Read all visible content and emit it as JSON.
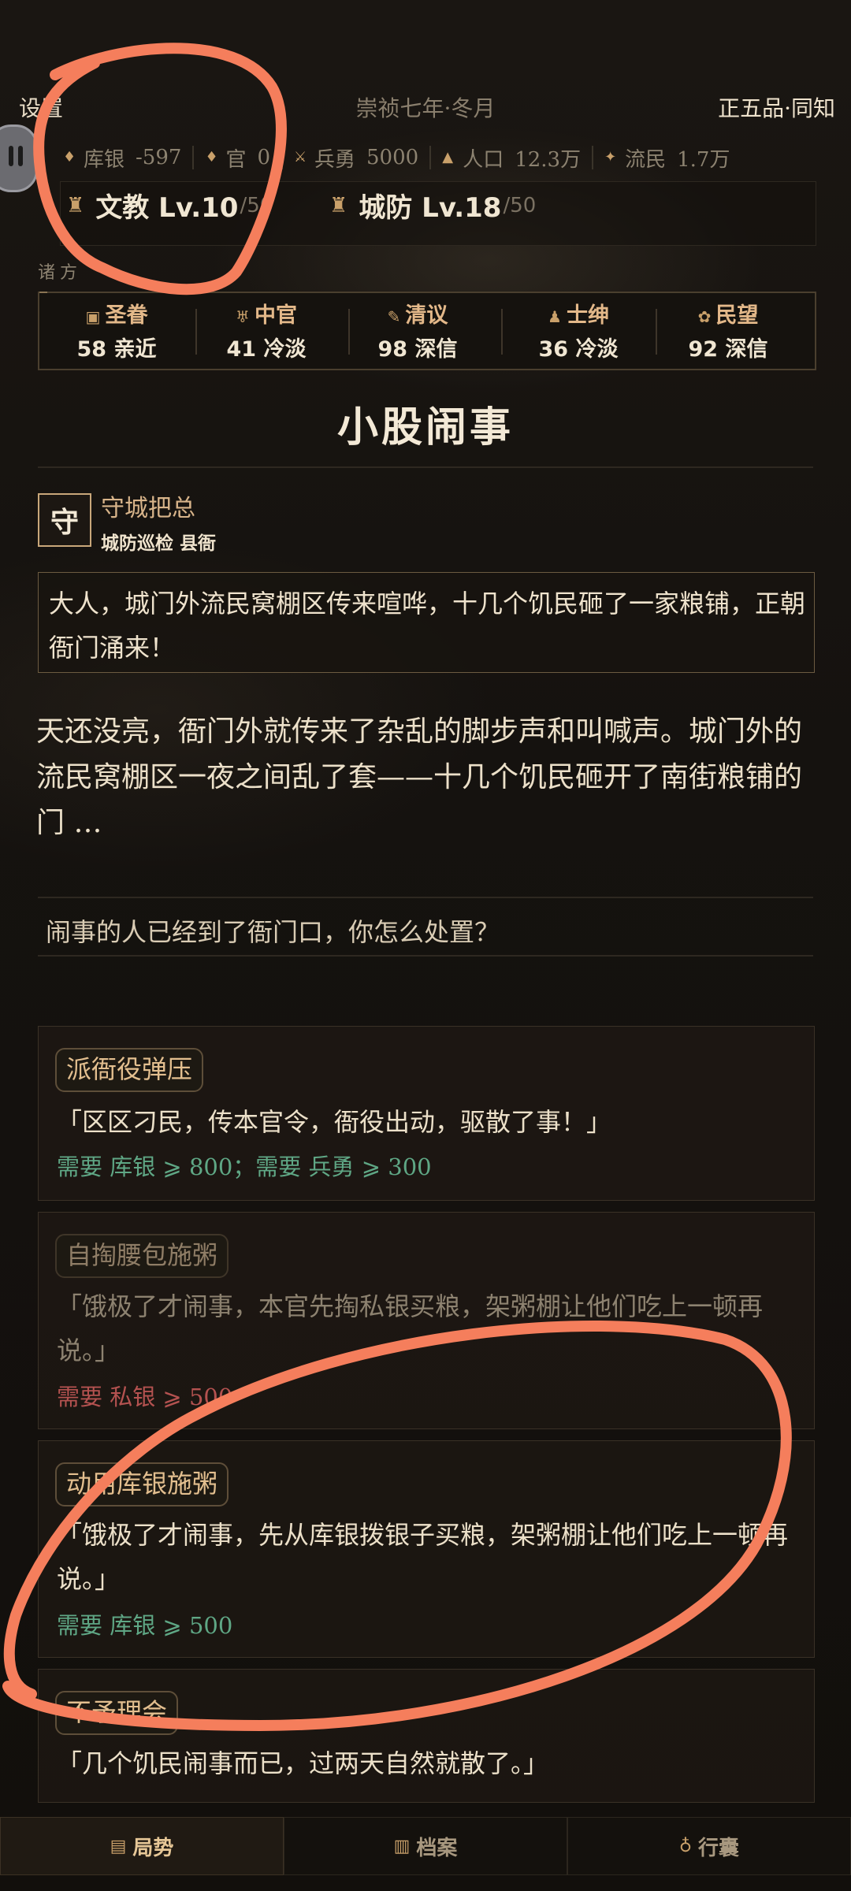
{
  "header": {
    "settings_label": "设置",
    "era": "崇祯七年·冬月",
    "rank": "正五品·同知"
  },
  "resources": [
    {
      "icon": "silver-icon",
      "label": "库银",
      "value": "-597"
    },
    {
      "icon": "official-silver-icon",
      "label": "官",
      "value": "0"
    },
    {
      "icon": "soldier-icon",
      "label": "兵勇",
      "value": "5000"
    },
    {
      "icon": "population-icon",
      "label": "人口",
      "value": "12.3万"
    },
    {
      "icon": "refugee-icon",
      "label": "流民",
      "value": "1.7万"
    }
  ],
  "levels": [
    {
      "icon": "education-icon",
      "label": "文教 Lv.10",
      "max": "/50"
    },
    {
      "icon": "defense-icon",
      "label": "城防 Lv.18",
      "max": "/50"
    }
  ],
  "factions_label": "诸方",
  "factions": [
    {
      "icon": "imperial-icon",
      "name": "圣眷",
      "value": "58 亲近"
    },
    {
      "icon": "eunuch-icon",
      "name": "中官",
      "value": "41 冷淡"
    },
    {
      "icon": "scholar-icon",
      "name": "清议",
      "value": "98 深信"
    },
    {
      "icon": "gentry-icon",
      "name": "士绅",
      "value": "36 冷淡"
    },
    {
      "icon": "people-icon",
      "name": "民望",
      "value": "92 深信"
    }
  ],
  "event": {
    "title": "小股闹事",
    "speaker_seal": "守",
    "speaker_name": "守城把总",
    "speaker_sub": "城防巡检 县衙",
    "speaker_quote": "大人，城门外流民窝棚区传来喧哗，十几个饥民砸了一家粮铺，正朝衙门涌来！",
    "narration": "天还没亮，衙门外就传来了杂乱的脚步声和叫喊声。城门外的流民窝棚区一夜之间乱了套——十几个饥民砸开了南街粮铺的门 …",
    "prompt": "闹事的人已经到了衙门口，你怎么处置？"
  },
  "choices": [
    {
      "tag": "派衙役弹压",
      "text": "「区区刁民，传本官令，衙役出动，驱散了事！」",
      "requirement": "需要 库银 ⩾ 800；需要 兵勇 ⩾ 300",
      "enabled": true
    },
    {
      "tag": "自掏腰包施粥",
      "text": "「饿极了才闹事，本官先掏私银买粮，架粥棚让他们吃上一顿再说。」",
      "requirement": "需要 私银 ⩾ 500",
      "enabled": false
    },
    {
      "tag": "动用库银施粥",
      "text": "「饿极了才闹事，先从库银拨银子买粮，架粥棚让他们吃上一顿再说。」",
      "requirement": "需要 库银 ⩾ 500",
      "enabled": true
    },
    {
      "tag": "不予理会",
      "text": "「几个饥民闹事而已，过两天自然就散了。」",
      "requirement": "",
      "enabled": true
    }
  ],
  "nav": [
    {
      "icon": "situation-icon",
      "label": "局势"
    },
    {
      "icon": "archive-icon",
      "label": "档案"
    },
    {
      "icon": "bag-icon",
      "label": "行囊"
    }
  ],
  "colors": {
    "background": "#17130f",
    "accent_gold": "#e3b889",
    "requirement_green": "#5fa785",
    "requirement_red": "#b45250",
    "annotation_orange": "#f57e5c"
  }
}
